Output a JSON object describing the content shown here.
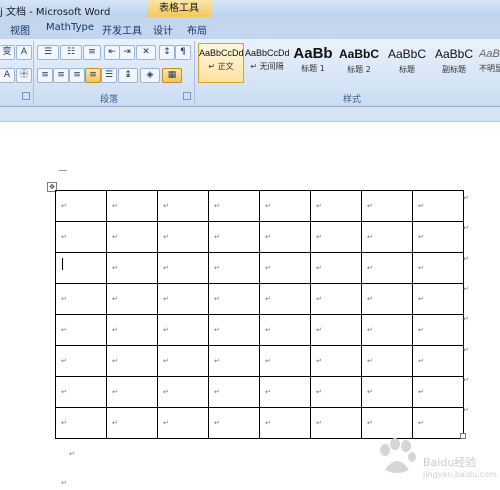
{
  "window": {
    "title": "j 文档 - Microsoft Word",
    "context_tab": "表格工具"
  },
  "tabs": [
    "视图",
    "MathType",
    "开发工具",
    "设计",
    "布局"
  ],
  "ribbon": {
    "paragraph_group_label": "段落",
    "styles_group_label": "样式",
    "styles": [
      {
        "preview": "AaBbCcDd",
        "name": "↵ 正文",
        "selected": true
      },
      {
        "preview": "AaBbCcDd",
        "name": "↵ 无间隔",
        "selected": false
      },
      {
        "preview": "AaBb",
        "name": "标题 1",
        "selected": false
      },
      {
        "preview": "AaBbC",
        "name": "标题 2",
        "selected": false
      },
      {
        "preview": "AaBbC",
        "name": "标题",
        "selected": false
      },
      {
        "preview": "AaBbC",
        "name": "副标题",
        "selected": false
      },
      {
        "preview": "AaBb",
        "name": "不明显",
        "selected": false
      }
    ]
  },
  "document": {
    "cell_mark": "↵",
    "rows": 8,
    "cols": 8,
    "active_cell": {
      "row": 3,
      "col": 1
    }
  },
  "watermark": {
    "text": "Baidu经验",
    "url": "jingyan.baidu.com"
  }
}
